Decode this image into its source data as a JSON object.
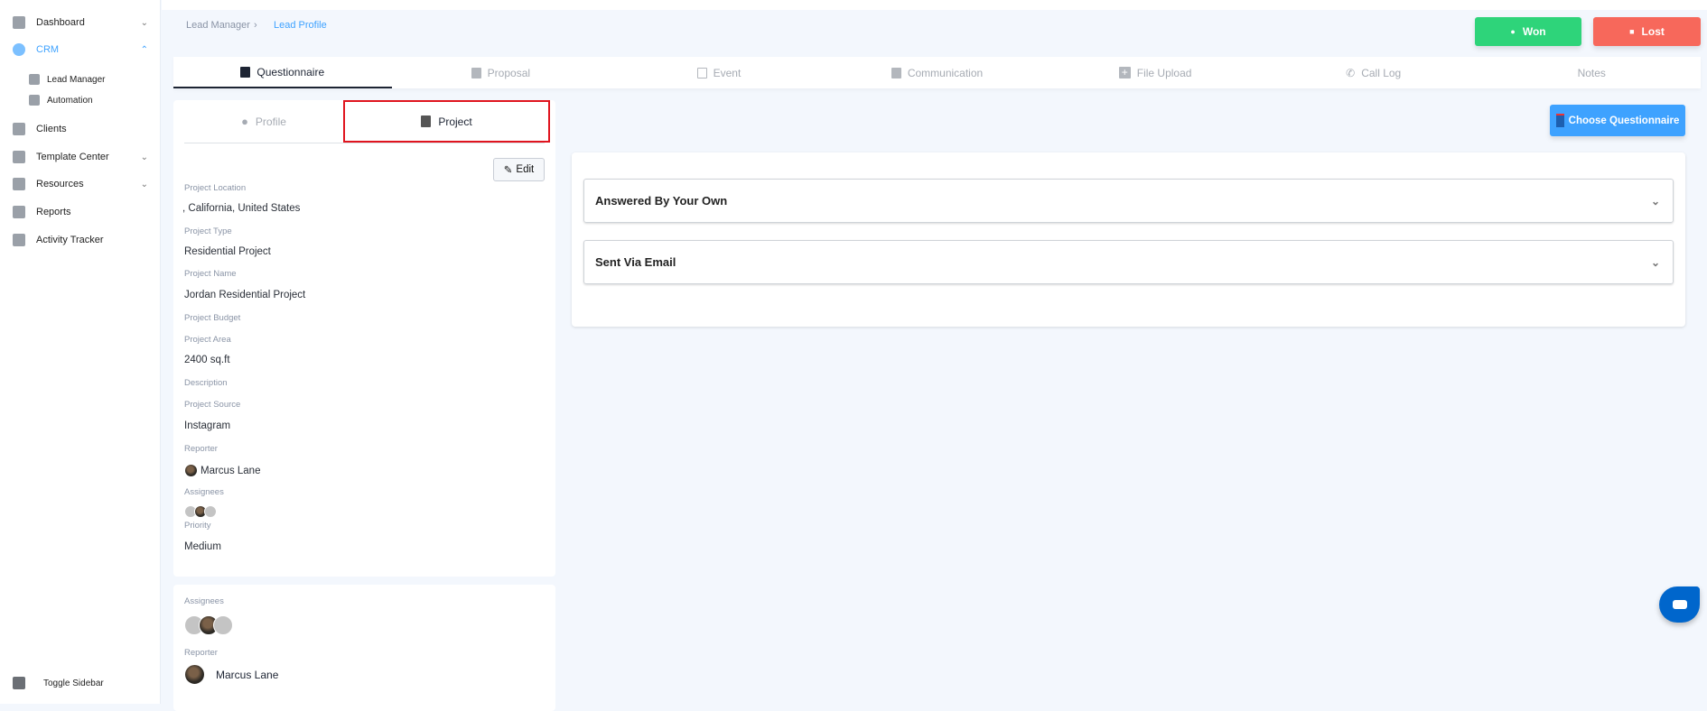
{
  "sidebar": {
    "items": [
      {
        "label": "Dashboard",
        "icon": "dashboard-icon",
        "chevron": "down"
      },
      {
        "label": "CRM",
        "icon": "crm-icon",
        "chevron": "up",
        "active": true
      },
      {
        "label": "Lead Manager",
        "icon": "lead-manager-icon"
      },
      {
        "label": "Automation",
        "icon": "automation-icon"
      },
      {
        "label": "Clients",
        "icon": "clients-icon"
      },
      {
        "label": "Template Center",
        "icon": "template-icon",
        "chevron": "down"
      },
      {
        "label": "Resources",
        "icon": "resources-icon",
        "chevron": "down"
      },
      {
        "label": "Reports",
        "icon": "reports-icon"
      },
      {
        "label": "Activity Tracker",
        "icon": "activity-icon"
      }
    ],
    "toggle": "Toggle Sidebar"
  },
  "breadcrumb": {
    "parent": "Lead Manager",
    "current": "Lead Profile"
  },
  "actions": {
    "won": "Won",
    "lost": "Lost"
  },
  "colors": {
    "won": "#2ed47a",
    "lost": "#f7685b",
    "accent": "#3ea2ff",
    "chat": "#0066cc"
  },
  "tabs": [
    "Questionnaire",
    "Proposal",
    "Event",
    "Communication",
    "File Upload",
    "Call Log",
    "Notes"
  ],
  "subtabs": {
    "profile": "Profile",
    "project": "Project"
  },
  "edit": "Edit",
  "fields": {
    "location_label": "Project Location",
    "location": ", California, United States",
    "type_label": "Project Type",
    "type": "Residential Project",
    "name_label": "Project Name",
    "name": "Jordan Residential Project",
    "budget_label": "Project Budget",
    "area_label": "Project Area",
    "area": "2400 sq.ft",
    "description_label": "Description",
    "source_label": "Project Source",
    "source": "Instagram",
    "reporter_label": "Reporter",
    "reporter": "Marcus Lane",
    "assignees_label": "Assignees",
    "priority_label": "Priority",
    "priority": "Medium"
  },
  "card2": {
    "assignees_label": "Assignees",
    "reporter_label": "Reporter",
    "reporter": "Marcus Lane"
  },
  "questionnaire": {
    "choose": "Choose Questionnaire",
    "sections": [
      "Answered By Your Own",
      "Sent Via Email"
    ]
  }
}
